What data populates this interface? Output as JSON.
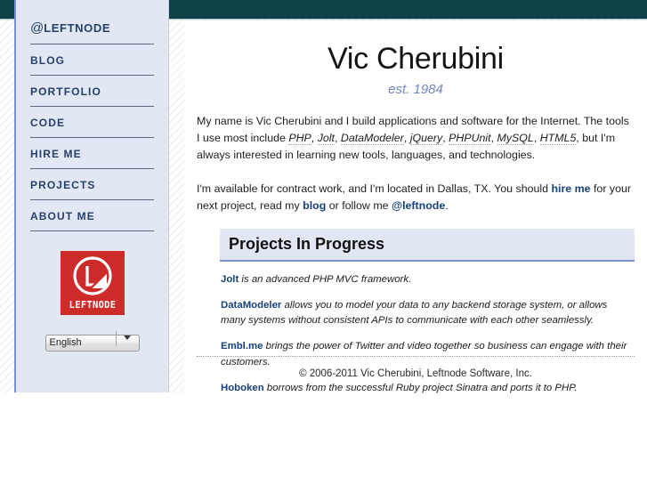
{
  "theme": {
    "topbar_color": "#0d4249",
    "sidebar_bg": "#e2e7f4",
    "sidebar_accent": "#7b91d6",
    "link_color": "#16417a",
    "tagline_color": "#6d86c4",
    "logo_bg": "#cd2a2a"
  },
  "sidebar": {
    "items": [
      {
        "label": "@LEFTNODE",
        "at_prefix": "@",
        "rest": "LEFTNODE"
      },
      {
        "label": "BLOG"
      },
      {
        "label": "PORTFOLIO"
      },
      {
        "label": "CODE"
      },
      {
        "label": "HIRE ME"
      },
      {
        "label": "PROJECTS"
      },
      {
        "label": "ABOUT ME"
      }
    ],
    "logo": {
      "wordmark": "LEFTNODE",
      "icon_name": "leftnode-logo-icon"
    },
    "language_select": {
      "selected": "English",
      "options": [
        "English"
      ]
    }
  },
  "main": {
    "title": "Vic Cherubini",
    "tagline": "est. 1984",
    "intro_paragraph": {
      "part1": "My name is Vic Cherubini and I build applications and software for the Internet. The tools I use most include ",
      "tools": [
        "PHP",
        "Jolt",
        "DataModeler",
        "jQuery",
        "PHPUnit",
        "MySQL",
        "HTML5"
      ],
      "part2": ", but I'm always interested in learning new tools, languages, and technologies."
    },
    "availability_paragraph": {
      "part1": "I'm available for contract work, and I'm located in Dallas, TX. You should ",
      "link_hire": "hire me",
      "part2": " for your next project, read my ",
      "link_blog": "blog",
      "part3": " or follow me ",
      "link_twitter": "@leftnode",
      "part4": "."
    },
    "projects": {
      "heading": "Projects In Progress",
      "items": [
        {
          "name": "Jolt",
          "description": " is an advanced PHP MVC framework."
        },
        {
          "name": "DataModeler",
          "description": " allows you to model your data to any backend storage system, or allows many systems without consistent APIs to communicate with each other seamlessly."
        },
        {
          "name": "Embl.me",
          "description": " brings the power of Twitter and video together so business can engage with their customers."
        },
        {
          "name": "Hoboken",
          "description": " borrows from the successful Ruby project Sinatra and ports it to PHP."
        }
      ]
    }
  },
  "footer": {
    "copyright": "© 2006-2011 Vic Cherubini, Leftnode Software, Inc."
  }
}
